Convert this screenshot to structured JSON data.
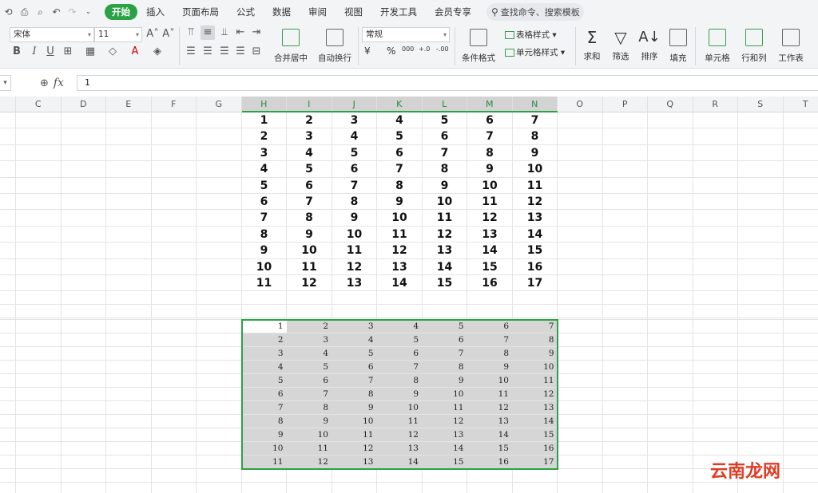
{
  "menu": {
    "items": [
      "开始",
      "插入",
      "页面布局",
      "公式",
      "数据",
      "审阅",
      "视图",
      "开发工具",
      "会员专享"
    ],
    "active_index": 0,
    "search_placeholder": "查找命令、搜索模板"
  },
  "ribbon": {
    "font_name": "宋体",
    "font_size": "11",
    "number_format": "常规",
    "buttons": {
      "merge_center": "合并居中",
      "wrap_text": "自动换行",
      "conditional_format": "条件格式",
      "table_style": "表格样式",
      "cell_style": "单元格样式",
      "sum": "求和",
      "filter": "筛选",
      "sort": "排序",
      "fill": "填充",
      "cell": "单元格",
      "row_col": "行和列",
      "worksheet": "工作表"
    },
    "format_symbols": {
      "currency": "¥",
      "percent": "%",
      "thousands": "000",
      "inc_decimal": "+.0",
      "dec_decimal": "-.00"
    }
  },
  "formula_bar": {
    "value": "1"
  },
  "grid": {
    "columns": [
      "C",
      "D",
      "E",
      "F",
      "G",
      "H",
      "I",
      "J",
      "K",
      "L",
      "M",
      "N",
      "O",
      "P",
      "Q",
      "R",
      "S",
      "T"
    ],
    "selected_columns": [
      "H",
      "I",
      "J",
      "K",
      "L",
      "M",
      "N"
    ],
    "top_table": [
      [
        "1",
        "2",
        "3",
        "4",
        "5",
        "6",
        "7"
      ],
      [
        "2",
        "3",
        "4",
        "5",
        "6",
        "7",
        "8"
      ],
      [
        "3",
        "4",
        "5",
        "6",
        "7",
        "8",
        "9"
      ],
      [
        "4",
        "5",
        "6",
        "7",
        "8",
        "9",
        "10"
      ],
      [
        "5",
        "6",
        "7",
        "8",
        "9",
        "10",
        "11"
      ],
      [
        "6",
        "7",
        "8",
        "9",
        "10",
        "11",
        "12"
      ],
      [
        "7",
        "8",
        "9",
        "10",
        "11",
        "12",
        "13"
      ],
      [
        "8",
        "9",
        "10",
        "11",
        "12",
        "13",
        "14"
      ],
      [
        "9",
        "10",
        "11",
        "12",
        "13",
        "14",
        "15"
      ],
      [
        "10",
        "11",
        "12",
        "13",
        "14",
        "15",
        "16"
      ],
      [
        "11",
        "12",
        "13",
        "14",
        "15",
        "16",
        "17"
      ]
    ],
    "bottom_table": [
      [
        "1",
        "2",
        "3",
        "4",
        "5",
        "6",
        "7"
      ],
      [
        "2",
        "3",
        "4",
        "5",
        "6",
        "7",
        "8"
      ],
      [
        "3",
        "4",
        "5",
        "6",
        "7",
        "8",
        "9"
      ],
      [
        "4",
        "5",
        "6",
        "7",
        "8",
        "9",
        "10"
      ],
      [
        "5",
        "6",
        "7",
        "8",
        "9",
        "10",
        "11"
      ],
      [
        "6",
        "7",
        "8",
        "9",
        "10",
        "11",
        "12"
      ],
      [
        "7",
        "8",
        "9",
        "10",
        "11",
        "12",
        "13"
      ],
      [
        "8",
        "9",
        "10",
        "11",
        "12",
        "13",
        "14"
      ],
      [
        "9",
        "10",
        "11",
        "12",
        "13",
        "14",
        "15"
      ],
      [
        "10",
        "11",
        "12",
        "13",
        "14",
        "15",
        "16"
      ],
      [
        "11",
        "12",
        "13",
        "14",
        "15",
        "16",
        "17"
      ]
    ]
  },
  "watermark": "云南龙网",
  "colors": {
    "accent_green": "#2ba245",
    "selection_gray": "#d6d6d6",
    "watermark_red": "#e23b24"
  }
}
